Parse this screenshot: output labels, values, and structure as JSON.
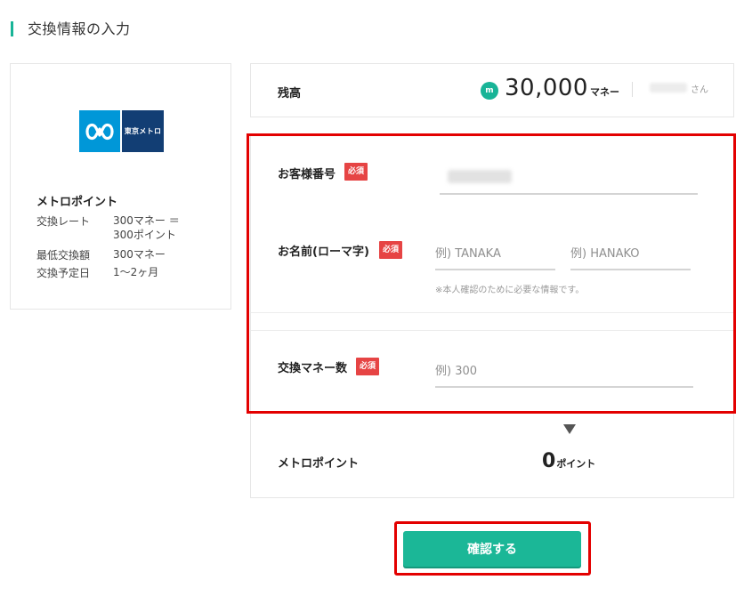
{
  "header": {
    "title": "交換情報の入力"
  },
  "partner": {
    "logo_text": "東京メトロ",
    "name": "メトロポイント",
    "rows": [
      {
        "key": "交換レート",
        "value_line1": "300マネー ＝",
        "value_line2": "300ポイント"
      },
      {
        "key": "最低交換額",
        "value": "300マネー"
      },
      {
        "key": "交換予定日",
        "value": "1〜2ヶ月"
      }
    ]
  },
  "balance": {
    "label": "残高",
    "coin_glyph": "m",
    "amount": "30,000",
    "unit": "マネー",
    "user_suffix": "さん"
  },
  "form": {
    "required_badge": "必須",
    "customer_number": {
      "label": "お客様番号"
    },
    "name_roman": {
      "label": "お名前(ローマ字)",
      "last_placeholder": "例) TANAKA",
      "first_placeholder": "例) HANAKO",
      "note": "※本人確認のために必要な情報です。"
    },
    "exchange_amount": {
      "label": "交換マネー数",
      "placeholder": "例) 300"
    }
  },
  "result": {
    "label": "メトロポイント",
    "value": "0",
    "unit": "ポイント"
  },
  "actions": {
    "confirm_label": "確認する"
  },
  "colors": {
    "accent": "#1bb797",
    "required": "#e64444",
    "highlight": "#e30000"
  }
}
